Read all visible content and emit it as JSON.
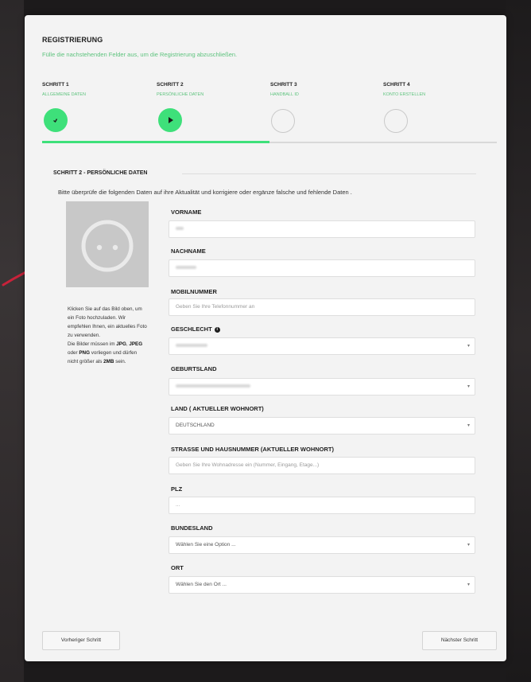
{
  "header": {
    "title": "REGISTRIERUNG",
    "subtitle": "Fülle die nachstehenden Felder aus, um die Registrierung abzuschließen."
  },
  "steps": [
    {
      "number": "SCHRITT 1",
      "name": "ALLGEMEINE DATEN",
      "state": "done"
    },
    {
      "number": "SCHRITT 2",
      "name": "PERSÖNLICHE DATEN",
      "state": "current"
    },
    {
      "number": "SCHRITT 3",
      "name": "HANDBALL ID",
      "state": "todo"
    },
    {
      "number": "SCHRITT 4",
      "name": "KONTO ERSTELLEN",
      "state": "todo"
    }
  ],
  "progress": 0.5,
  "section": {
    "title": "SCHRITT 2 - PERSÖNLICHE DATEN",
    "intro": "Bitte überprüfe die folgenden Daten auf ihre Aktualität und korrigiere oder ergänze falsche und fehlende Daten ."
  },
  "photo": {
    "icon": "face-placeholder-icon",
    "text_part1": "Klicken Sie auf das Bild oben, um ein Foto hochzuladen. Wir empfehlen Ihnen, ein aktuelles Foto zu verwenden.",
    "text_part2": "Die Bilder müssen im ",
    "fmt_jpg": "JPG",
    "sep1": ", ",
    "fmt_jpeg": "JPEG",
    "sep2": " oder ",
    "fmt_png": "PNG",
    "text_part3": " vorliegen und dürfen nicht größer als ",
    "max_size": "2MB",
    "text_part4": " sein."
  },
  "fields": {
    "vorname": {
      "label": "VORNAME"
    },
    "nachname": {
      "label": "NACHNAME"
    },
    "mobil": {
      "label": "MOBILNUMMER",
      "placeholder": "Geben Sie Ihre Telefonnummer an"
    },
    "geschlecht": {
      "label": "GESCHLECHT"
    },
    "geburtsland": {
      "label": "GEBURTSLAND"
    },
    "land": {
      "label": "LAND ( AKTUELLER WOHNORT)",
      "value": "DEUTSCHLAND"
    },
    "strasse": {
      "label": "STRASSE UND HAUSNUMMER (AKTUELLER WOHNORT)",
      "placeholder": "Geben Sie Ihre Wohnadresse ein (Nummer, Eingang, Etage...)"
    },
    "plz": {
      "label": "PLZ",
      "placeholder": "..."
    },
    "bundesland": {
      "label": "BUNDESLAND",
      "value": "Wählen Sie eine Option ..."
    },
    "ort": {
      "label": "ORT",
      "value": "Wählen Sie den Ort ..."
    }
  },
  "buttons": {
    "prev": "Vorheriger Schritt",
    "next": "Nächster Schritt"
  },
  "colors": {
    "accent": "#3ee07a",
    "accent_text": "#5ec37e",
    "annotation": "#c8223a"
  }
}
